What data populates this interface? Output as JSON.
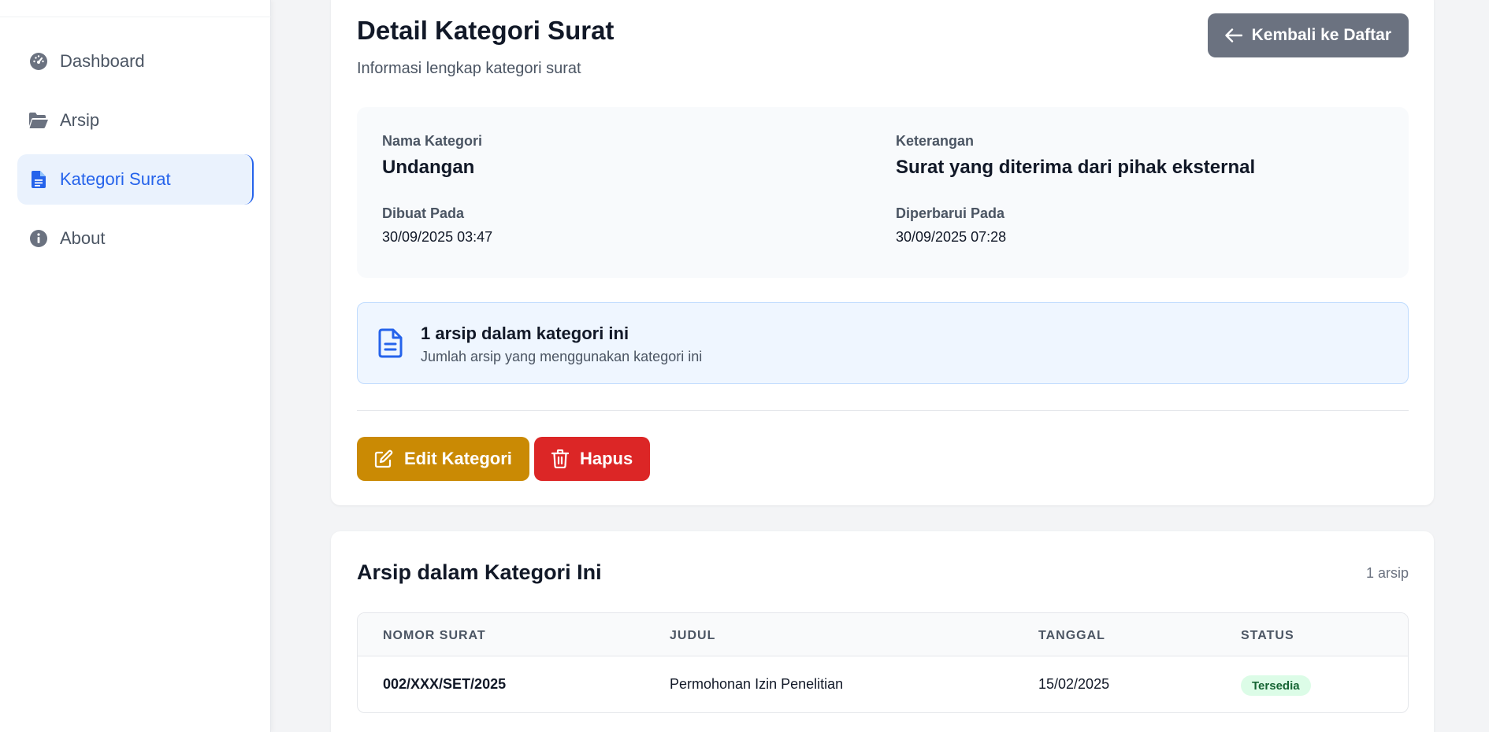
{
  "sidebar": {
    "items": [
      {
        "label": "Dashboard",
        "icon": "dashboard-gauge-icon",
        "active": false
      },
      {
        "label": "Arsip",
        "icon": "folder-open-icon",
        "active": false
      },
      {
        "label": "Kategori Surat",
        "icon": "document-icon",
        "active": true
      },
      {
        "label": "About",
        "icon": "info-circle-icon",
        "active": false
      }
    ]
  },
  "detail": {
    "title": "Detail Kategori Surat",
    "subtitle": "Informasi lengkap kategori surat",
    "back_label": "Kembali ke Daftar",
    "fields": {
      "nama_label": "Nama Kategori",
      "nama_value": "Undangan",
      "keterangan_label": "Keterangan",
      "keterangan_value": "Surat yang diterima dari pihak eksternal",
      "dibuat_label": "Dibuat Pada",
      "dibuat_value": "30/09/2025 03:47",
      "diperbarui_label": "Diperbarui Pada",
      "diperbarui_value": "30/09/2025 07:28"
    },
    "notice": {
      "title": "1 arsip dalam kategori ini",
      "description": "Jumlah arsip yang menggunakan kategori ini"
    },
    "actions": {
      "edit_label": "Edit Kategori",
      "delete_label": "Hapus"
    }
  },
  "archive": {
    "title": "Arsip dalam Kategori Ini",
    "count": "1 arsip",
    "columns": [
      "NOMOR SURAT",
      "JUDUL",
      "TANGGAL",
      "STATUS"
    ],
    "rows": [
      {
        "nomor": "002/XXX/SET/2025",
        "judul": "Permohonan Izin Penelitian",
        "tanggal": "15/02/2025",
        "status": "Tersedia"
      }
    ]
  },
  "colors": {
    "accent": "#2563eb",
    "edit": "#ca8a04",
    "delete": "#dc2626",
    "back": "#6b7280",
    "status_bg": "#dcfce7",
    "status_text": "#166534"
  }
}
